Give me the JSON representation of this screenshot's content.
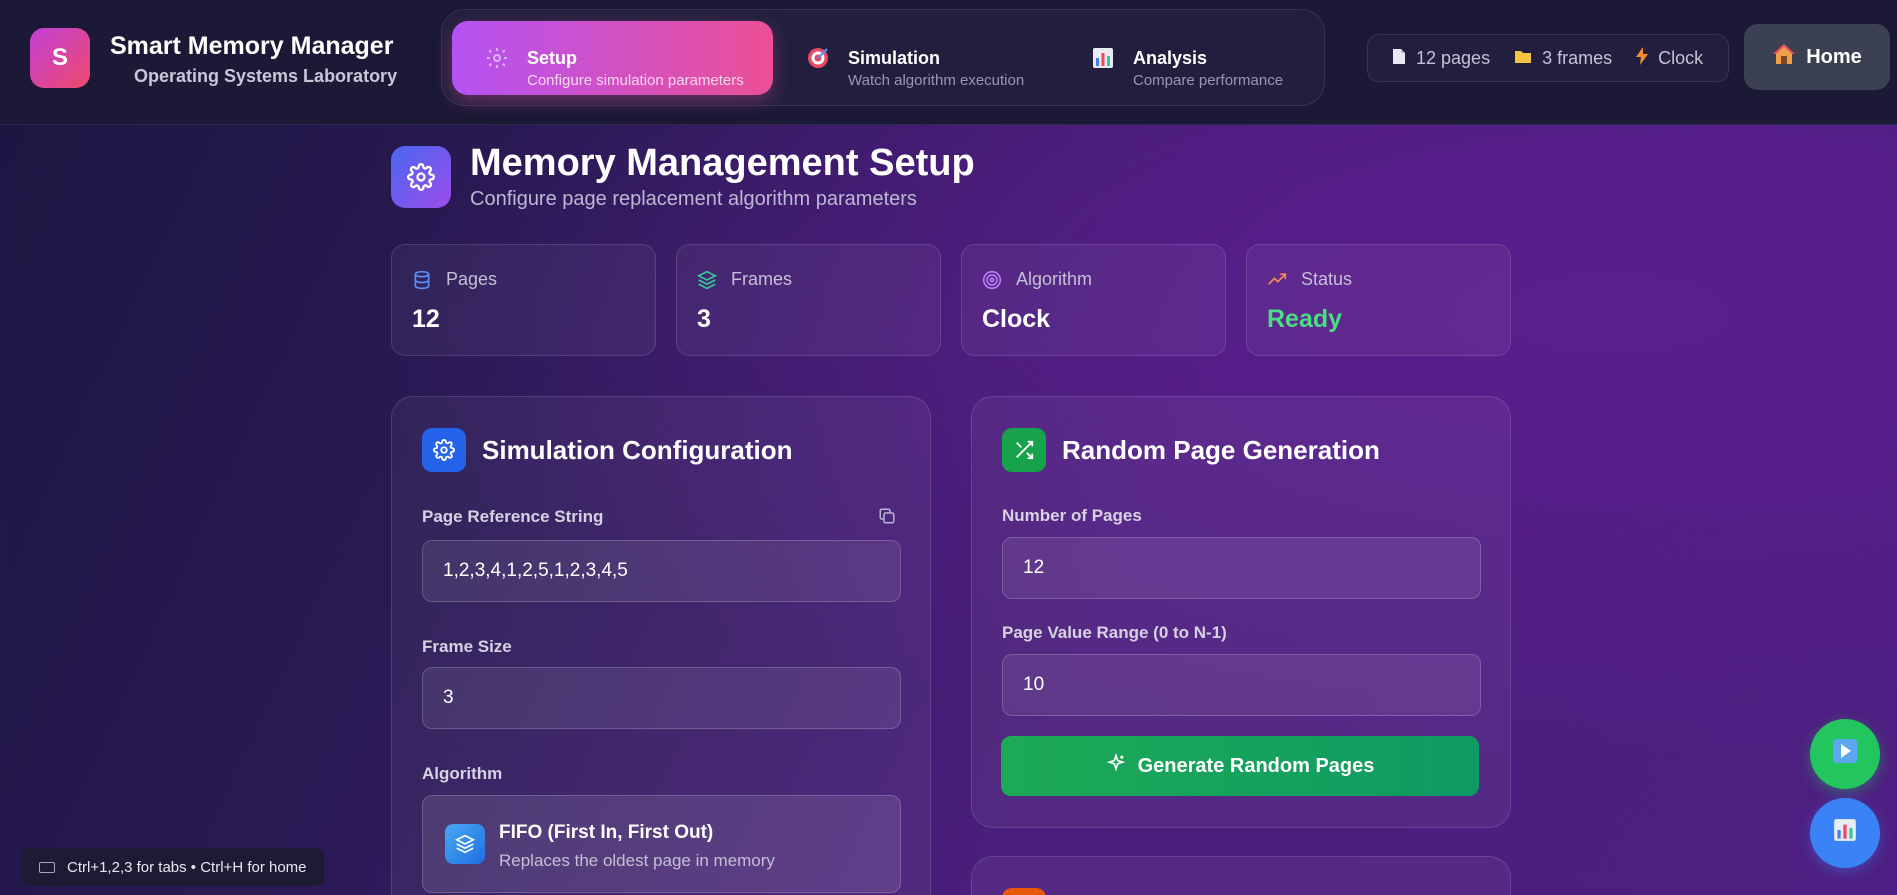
{
  "app": {
    "logo_letter": "S",
    "title": "Smart Memory Manager",
    "subtitle": "Operating Systems Laboratory"
  },
  "tabs": [
    {
      "label": "Setup",
      "sub": "Configure simulation parameters",
      "icon": "gear-icon",
      "active": true
    },
    {
      "label": "Simulation",
      "sub": "Watch algorithm execution",
      "icon": "target-icon",
      "active": false
    },
    {
      "label": "Analysis",
      "sub": "Compare performance",
      "icon": "bar-chart-icon",
      "active": false
    }
  ],
  "header_stats": {
    "pages": "12 pages",
    "frames": "3 frames",
    "algorithm": "Clock"
  },
  "home_button": {
    "label": "Home",
    "icon": "house-icon"
  },
  "page": {
    "title": "Memory Management Setup",
    "subtitle": "Configure page replacement algorithm parameters"
  },
  "stat_cards": [
    {
      "label": "Pages",
      "value": "12",
      "icon": "database-icon",
      "color": "#5b8ff9"
    },
    {
      "label": "Frames",
      "value": "3",
      "icon": "layers-icon",
      "color": "#34c99a"
    },
    {
      "label": "Algorithm",
      "value": "Clock",
      "icon": "target-icon",
      "color": "#b87cf7"
    },
    {
      "label": "Status",
      "value": "Ready",
      "icon": "trending-up-icon",
      "color": "#fb8a4c",
      "value_color": "#4ade80"
    }
  ],
  "config_panel": {
    "title": "Simulation Configuration",
    "ref_label": "Page Reference String",
    "ref_value": "1,2,3,4,1,2,5,1,2,3,4,5",
    "frame_label": "Frame Size",
    "frame_value": "3",
    "algo_label": "Algorithm",
    "algo_name": "FIFO (First In, First Out)",
    "algo_desc": "Replaces the oldest page in memory"
  },
  "random_panel": {
    "title": "Random Page Generation",
    "num_label": "Number of Pages",
    "num_value": "12",
    "range_label": "Page Value Range (0 to N-1)",
    "range_value": "10",
    "button_label": "Generate Random Pages"
  },
  "shortcut_hint": "Ctrl+1,2,3 for tabs • Ctrl+H for home",
  "colors": {
    "accent_pink": "#ec4f95",
    "accent_purple": "#b453f4",
    "green": "#1daa55",
    "blue": "#2563eb"
  }
}
